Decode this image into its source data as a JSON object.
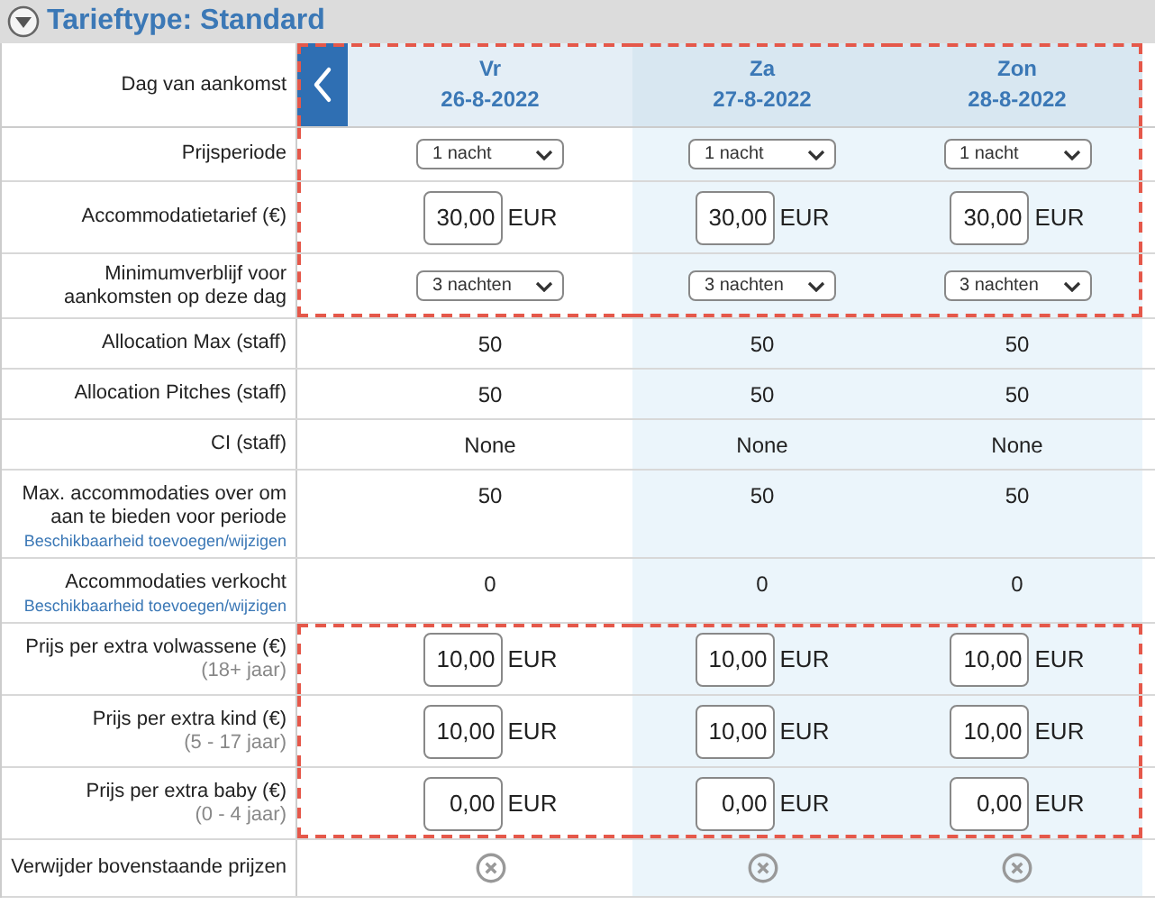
{
  "title": "Tarieftype: Standard",
  "header": {
    "label": "Dag van aankomst",
    "highlighted": true,
    "days": [
      {
        "weekday": "Vr",
        "date": "26-8-2022",
        "weekend": false
      },
      {
        "weekday": "Za",
        "date": "27-8-2022",
        "weekend": true
      },
      {
        "weekday": "Zon",
        "date": "28-8-2022",
        "weekend": true
      }
    ]
  },
  "rows": [
    {
      "kind": "select",
      "label": "Prijsperiode",
      "highlighted": true,
      "cells": [
        "1 nacht",
        "1 nacht",
        "1 nacht"
      ]
    },
    {
      "kind": "money",
      "label": "Accommodatietarief (€)",
      "highlighted": true,
      "cells": [
        {
          "value": "30,00",
          "unit": "EUR"
        },
        {
          "value": "30,00",
          "unit": "EUR"
        },
        {
          "value": "30,00",
          "unit": "EUR"
        }
      ]
    },
    {
      "kind": "select",
      "label": "Minimumverblijf voor aankomsten op deze dag",
      "highlighted": true,
      "cells": [
        "3 nachten",
        "3 nachten",
        "3 nachten"
      ]
    },
    {
      "kind": "text",
      "label": "Allocation Max (staff)",
      "highlighted": false,
      "cells": [
        "50",
        "50",
        "50"
      ]
    },
    {
      "kind": "text",
      "label": "Allocation Pitches (staff)",
      "highlighted": false,
      "cells": [
        "50",
        "50",
        "50"
      ]
    },
    {
      "kind": "text",
      "label": "CI (staff)",
      "highlighted": false,
      "cells": [
        "None",
        "None",
        "None"
      ]
    },
    {
      "kind": "text",
      "label": "Max. accommodaties over om aan te bieden voor periode",
      "link": "Beschikbaarheid toevoegen/wijzigen",
      "highlighted": false,
      "cells": [
        "50",
        "50",
        "50"
      ]
    },
    {
      "kind": "text",
      "label": "Accommodaties verkocht",
      "link": "Beschikbaarheid toevoegen/wijzigen",
      "highlighted": false,
      "cells": [
        "0",
        "0",
        "0"
      ]
    },
    {
      "kind": "money",
      "label": "Prijs per extra volwassene (€)",
      "sublabel": "(18+ jaar)",
      "highlighted": true,
      "cells": [
        {
          "value": "10,00",
          "unit": "EUR"
        },
        {
          "value": "10,00",
          "unit": "EUR"
        },
        {
          "value": "10,00",
          "unit": "EUR"
        }
      ]
    },
    {
      "kind": "money",
      "label": "Prijs per extra kind (€)",
      "sublabel": "(5 - 17 jaar)",
      "highlighted": true,
      "cells": [
        {
          "value": "10,00",
          "unit": "EUR"
        },
        {
          "value": "10,00",
          "unit": "EUR"
        },
        {
          "value": "10,00",
          "unit": "EUR"
        }
      ]
    },
    {
      "kind": "money",
      "label": "Prijs per extra baby (€)",
      "sublabel": "(0 - 4 jaar)",
      "highlighted": true,
      "cells": [
        {
          "value": "0,00",
          "unit": "EUR"
        },
        {
          "value": "0,00",
          "unit": "EUR"
        },
        {
          "value": "0,00",
          "unit": "EUR"
        }
      ]
    },
    {
      "kind": "remove",
      "label": "Verwijder bovenstaande prijzen",
      "highlighted": false,
      "cells": [
        "",
        "",
        ""
      ]
    }
  ]
}
